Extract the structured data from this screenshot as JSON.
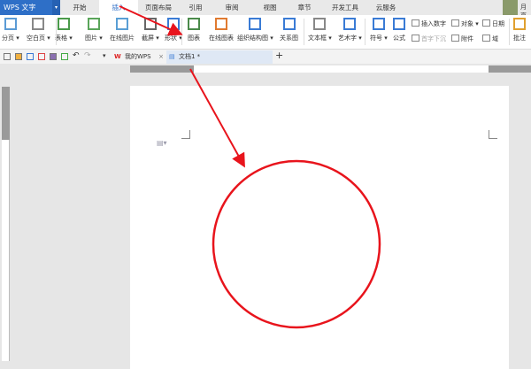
{
  "app": {
    "title": "WPS 文字"
  },
  "menu_tabs": [
    "开始",
    "插入",
    "页面布局",
    "引用",
    "审阅",
    "视图",
    "章节",
    "开发工具",
    "云服务"
  ],
  "active_tab": "插入",
  "user": {
    "name": "月亮"
  },
  "ribbon": {
    "big": [
      {
        "label": "分页 ▾",
        "icon": "page-break-icon"
      },
      {
        "label": "空白页 ▾",
        "icon": "blank-page-icon"
      },
      {
        "label": "表格 ▾",
        "icon": "table-icon"
      },
      {
        "label": "图片 ▾",
        "icon": "picture-icon"
      },
      {
        "label": "在线图片",
        "icon": "online-picture-icon"
      },
      {
        "label": "截屏 ▾",
        "icon": "screenshot-icon"
      },
      {
        "label": "形状 ▾",
        "icon": "shapes-icon"
      },
      {
        "label": "图表",
        "icon": "chart-icon"
      },
      {
        "label": "在线图表",
        "icon": "online-chart-icon"
      },
      {
        "label": "组织结构图 ▾",
        "icon": "org-chart-icon"
      },
      {
        "label": "关系图",
        "icon": "relation-chart-icon"
      },
      {
        "label": "文本框 ▾",
        "icon": "textbox-icon"
      },
      {
        "label": "艺术字 ▾",
        "icon": "wordart-icon"
      },
      {
        "label": "符号 ▾",
        "icon": "omega-icon"
      },
      {
        "label": "公式",
        "icon": "pi-icon"
      },
      {
        "label": "批注",
        "icon": "comment-icon"
      }
    ],
    "small": [
      "插入数字",
      "首字下沉",
      "对象 ▾",
      "附件",
      "日期",
      "域"
    ]
  },
  "doc_tabs": [
    {
      "label": "我的WPS"
    },
    {
      "label": "文档1 *"
    }
  ],
  "colors": {
    "accent": "#2e6fc7",
    "annotation": "#e8141c"
  }
}
